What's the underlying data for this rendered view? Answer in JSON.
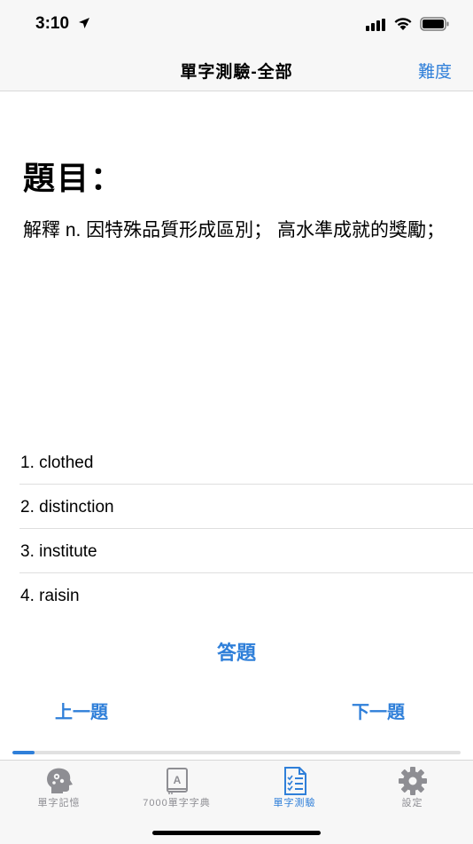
{
  "status_bar": {
    "time": "3:10"
  },
  "nav": {
    "title": "單字測驗-全部",
    "right_button": "難度"
  },
  "question": {
    "heading": "題目：",
    "text": "解釋 n. 因特殊品質形成區別； 高水準成就的獎勵；"
  },
  "options": [
    "1. clothed",
    "2. distinction",
    "3. institute",
    "4. raisin"
  ],
  "answer_button": "答題",
  "prev_button": "上一題",
  "next_button": "下一題",
  "progress": 0.05,
  "colors": {
    "accent": "#2f7fd9",
    "inactive": "#8e8e93"
  },
  "tabs": [
    {
      "label": "單字記憶",
      "icon": "brain-head-icon",
      "active": false
    },
    {
      "label": "7000單字字典",
      "icon": "dictionary-book-icon",
      "active": false
    },
    {
      "label": "單字測驗",
      "icon": "quiz-checklist-icon",
      "active": true
    },
    {
      "label": "設定",
      "icon": "gear-icon",
      "active": false
    }
  ]
}
